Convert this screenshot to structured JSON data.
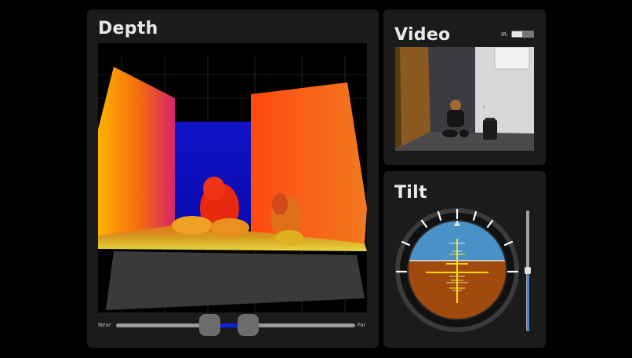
{
  "depth": {
    "title": "Depth",
    "range_slider": {
      "min_label": "Near",
      "max_label": "Far"
    }
  },
  "video": {
    "title": "Video",
    "ir_toggle": {
      "label": "IR:",
      "state": "off"
    }
  },
  "tilt": {
    "title": "Tilt",
    "slider_level": 0.5
  },
  "colors": {
    "panel": "#1b1b1b",
    "sky": "#4a91c8",
    "ground": "#a14a0e",
    "indicator": "#ffee00",
    "depth_near": "#ffd400",
    "depth_far": "#1010d0"
  }
}
